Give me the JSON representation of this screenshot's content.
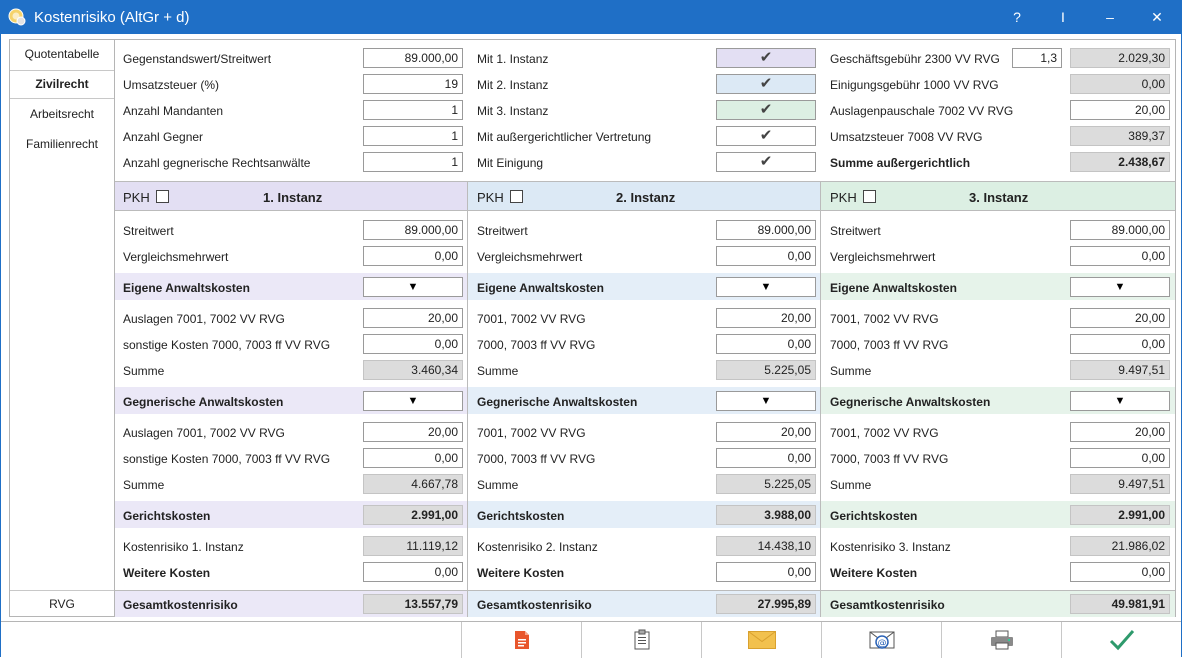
{
  "window": {
    "title": "Kostenrisiko (AltGr + d)",
    "help": "?",
    "pin": "I",
    "minimize": "–",
    "close": "✕"
  },
  "sidebar": {
    "items": [
      "Quotentabelle",
      "Zivilrecht",
      "Arbeitsrecht",
      "Familienrecht"
    ],
    "bottom": "RVG"
  },
  "general": {
    "labels": [
      "Gegenstandswert/Streitwert",
      "Umsatzsteuer (%)",
      "Anzahl Mandanten",
      "Anzahl Gegner",
      "Anzahl gegnerische Rechtsanwälte"
    ],
    "values": [
      "89.000,00",
      "19",
      "1",
      "1",
      "1"
    ]
  },
  "options": {
    "labels": [
      "Mit 1. Instanz",
      "Mit 2. Instanz",
      "Mit 3. Instanz",
      "Mit außergerichtlicher Vertretung",
      "Mit Einigung"
    ],
    "check": "✔"
  },
  "extrajudicial": {
    "labels": [
      "Geschäftsgebühr 2300 VV RVG",
      "Einigungsgebühr 1000 VV RVG",
      "Auslagenpauschale 7002 VV RVG",
      "Umsatzsteuer 7008 VV RVG",
      "Summe außergerichtlich"
    ],
    "factor": "1,3",
    "values": [
      "2.029,30",
      "0,00",
      "20,00",
      "389,37",
      "2.438,67"
    ]
  },
  "pkh": "PKH",
  "dropdown_arrow": "▼",
  "instances": [
    {
      "title": "1. Instanz",
      "streitwert_label": "Streitwert",
      "streitwert": "89.000,00",
      "vergleich_label": "Vergleichsmehrwert",
      "vergleich": "0,00",
      "own_label": "Eigene Anwaltskosten",
      "own_auslagen_label": "Auslagen 7001, 7002 VV RVG",
      "own_auslagen": "20,00",
      "own_sonst_label": "sonstige Kosten 7000, 7003 ff VV RVG",
      "own_sonst": "0,00",
      "own_sum_label": "Summe",
      "own_sum": "3.460,34",
      "opp_label": "Gegnerische Anwaltskosten",
      "opp_auslagen_label": "Auslagen 7001, 7002 VV RVG",
      "opp_auslagen": "20,00",
      "opp_sonst_label": "sonstige Kosten 7000, 7003 ff VV RVG",
      "opp_sonst": "0,00",
      "opp_sum_label": "Summe",
      "opp_sum": "4.667,78",
      "court_label": "Gerichtskosten",
      "court": "2.991,00",
      "risk_label": "Kostenrisiko 1. Instanz",
      "risk": "11.119,12",
      "more_label": "Weitere Kosten",
      "more": "0,00",
      "total_label": "Gesamtkostenrisiko",
      "total": "13.557,79"
    },
    {
      "title": "2. Instanz",
      "streitwert_label": "Streitwert",
      "streitwert": "89.000,00",
      "vergleich_label": "Vergleichsmehrwert",
      "vergleich": "0,00",
      "own_label": "Eigene Anwaltskosten",
      "own_auslagen_label": "7001, 7002 VV RVG",
      "own_auslagen": "20,00",
      "own_sonst_label": "7000, 7003 ff VV RVG",
      "own_sonst": "0,00",
      "own_sum_label": "Summe",
      "own_sum": "5.225,05",
      "opp_label": "Gegnerische Anwaltskosten",
      "opp_auslagen_label": "7001, 7002 VV RVG",
      "opp_auslagen": "20,00",
      "opp_sonst_label": "7000, 7003 ff VV RVG",
      "opp_sonst": "0,00",
      "opp_sum_label": "Summe",
      "opp_sum": "5.225,05",
      "court_label": "Gerichtskosten",
      "court": "3.988,00",
      "risk_label": "Kostenrisiko 2. Instanz",
      "risk": "14.438,10",
      "more_label": "Weitere Kosten",
      "more": "0,00",
      "total_label": "Gesamtkostenrisiko",
      "total": "27.995,89"
    },
    {
      "title": "3. Instanz",
      "streitwert_label": "Streitwert",
      "streitwert": "89.000,00",
      "vergleich_label": "Vergleichsmehrwert",
      "vergleich": "0,00",
      "own_label": "Eigene Anwaltskosten",
      "own_auslagen_label": "7001, 7002 VV RVG",
      "own_auslagen": "20,00",
      "own_sonst_label": "7000, 7003 ff VV RVG",
      "own_sonst": "0,00",
      "own_sum_label": "Summe",
      "own_sum": "9.497,51",
      "opp_label": "Gegnerische Anwaltskosten",
      "opp_auslagen_label": "7001, 7002 VV RVG",
      "opp_auslagen": "20,00",
      "opp_sonst_label": "7000, 7003 ff VV RVG",
      "opp_sonst": "0,00",
      "opp_sum_label": "Summe",
      "opp_sum": "9.497,51",
      "court_label": "Gerichtskosten",
      "court": "2.991,00",
      "risk_label": "Kostenrisiko 3. Instanz",
      "risk": "21.986,02",
      "more_label": "Weitere Kosten",
      "more": "0,00",
      "total_label": "Gesamtkostenrisiko",
      "total": "49.981,91"
    }
  ],
  "footer": {
    "icons": [
      "pdf-document-icon",
      "clipboard-icon",
      "mail-envelope-icon",
      "email-at-icon",
      "printer-icon",
      "confirm-check-icon"
    ]
  },
  "colors": {
    "titlebar": "#1f6fc6",
    "instance1_head": "#e3dff3",
    "instance1_band": "#ebe8f7",
    "instance2_head": "#dce9f5",
    "instance2_band": "#e4eef8",
    "instance3_head": "#dcefe3",
    "instance3_band": "#e6f3ea",
    "readonly": "#dcdcdc",
    "accent_green": "#2e9a6c",
    "pdf_orange": "#e8562c",
    "mail_yellow": "#f2c14e"
  }
}
